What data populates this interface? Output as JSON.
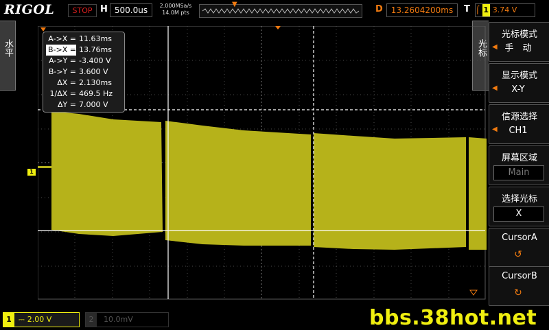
{
  "header": {
    "brand": "RIGOL",
    "run_state": "STOP",
    "h_label": "H",
    "timebase": "500.0us",
    "sample_rate": "2.000MSa/s",
    "memory_depth": "14.0M pts",
    "d_label": "D",
    "delay": "13.2604200ms",
    "t_label": "T",
    "trigger_channel": "1",
    "trigger_level": "3.74 V"
  },
  "side_tabs": {
    "left": "水平",
    "right": "光标"
  },
  "cursor_readout": {
    "rows": [
      {
        "label": "A->X =",
        "value": "11.63ms"
      },
      {
        "label": "B->X =",
        "value": "13.76ms"
      },
      {
        "label": "A->Y =",
        "value": "-3.400 V"
      },
      {
        "label": "B->Y =",
        "value": "3.600 V"
      },
      {
        "label": "ΔX =",
        "value": "2.130ms"
      },
      {
        "label": "1/ΔX =",
        "value": "469.5 Hz"
      },
      {
        "label": "ΔY =",
        "value": "7.000 V"
      }
    ]
  },
  "menu": {
    "items": [
      {
        "title": "光标模式",
        "value": "手　动"
      },
      {
        "title": "显示模式",
        "value": "X-Y"
      },
      {
        "title": "信源选择",
        "value": "CH1"
      },
      {
        "title": "屏幕区域",
        "value": "Main"
      },
      {
        "title": "选择光标",
        "value": "X"
      },
      {
        "title": "CursorA",
        "value": ""
      },
      {
        "title": "CursorB",
        "value": ""
      }
    ]
  },
  "footer": {
    "ch1_number": "1",
    "ch1_coupling": "⎓",
    "ch1_scale": "2.00 V",
    "ch2_number": "2",
    "ch2_scale": "10.0mV",
    "watermark": "bbs.38hot.net"
  },
  "colors": {
    "ch1": "#f0ef10",
    "trace": "#b6b21a",
    "accent": "#f07a10",
    "stop": "#e02020"
  }
}
